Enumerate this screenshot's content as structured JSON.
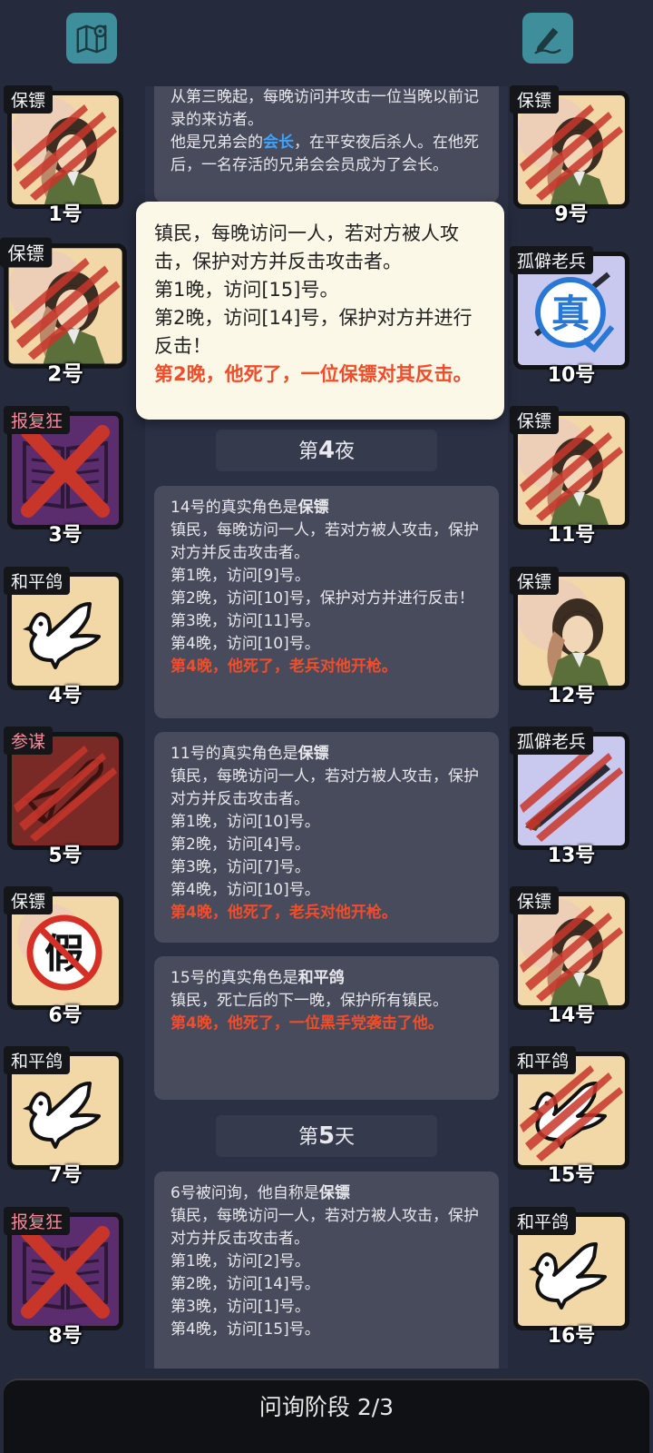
{
  "header": {
    "map_icon": "map-pin-icon",
    "notes_icon": "pen-note-icon"
  },
  "log": {
    "top_partial": {
      "line1": "从第三晚起，每晚访问并攻击一位当晚以前记录的来访者。",
      "line2_a": "他是兄弟会的",
      "line2_hl": "会长",
      "line2_b": "，在平安夜后杀人。在他死后，一名存活的兄弟会会员成为了会长。"
    },
    "night4_label": "第",
    "night4_num": "4",
    "night4_suffix": "夜",
    "entry14": {
      "head_a": "14号的真实角色是",
      "head_b": "保镖",
      "desc": "镇民，每晚访问一人，若对方被人攻击，保护对方并反击攻击者。",
      "lines": [
        "第1晚，访问[9]号。",
        "第2晚，访问[10]号，保护对方并进行反击！",
        "第3晚，访问[11]号。",
        "第4晚，访问[10]号。"
      ],
      "death": "第4晚，他死了，老兵对他开枪。"
    },
    "entry11": {
      "head_a": "11号的真实角色是",
      "head_b": "保镖",
      "desc": "镇民，每晚访问一人，若对方被人攻击，保护对方并反击攻击者。",
      "lines": [
        "第1晚，访问[10]号。",
        "第2晚，访问[4]号。",
        "第3晚，访问[7]号。",
        "第4晚，访问[10]号。"
      ],
      "death": "第4晚，他死了，老兵对他开枪。"
    },
    "entry15": {
      "head_a": "15号的真实角色是",
      "head_b": "和平鸽",
      "desc": "镇民，死亡后的下一晚，保护所有镇民。",
      "death": "第4晚，他死了，一位黑手党袭击了他。"
    },
    "day5_label": "第",
    "day5_num": "5",
    "day5_suffix": "天",
    "entry6": {
      "head_a": "6号被问询，他自称是",
      "head_b": "保镖",
      "desc": "镇民，每晚访问一人，若对方被人攻击，保护对方并反击攻击者。",
      "lines": [
        "第1晚，访问[2]号。",
        "第2晚，访问[14]号。",
        "第3晚，访问[1]号。",
        "第4晚，访问[15]号。"
      ]
    }
  },
  "popup": {
    "desc": "镇民，每晚访问一人，若对方被人攻击，保护对方并反击攻击者。",
    "lines": [
      "第1晚，访问[15]号。",
      "第2晚，访问[14]号，保护对方并进行反击！"
    ],
    "death": "第2晚，他死了，一位保镖对其反击。"
  },
  "players": [
    {
      "num": "1号",
      "role": "保镖"
    },
    {
      "num": "2号",
      "role": "保镖"
    },
    {
      "num": "3号",
      "role": "报复狂"
    },
    {
      "num": "4号",
      "role": "和平鸽"
    },
    {
      "num": "5号",
      "role": "参谋"
    },
    {
      "num": "6号",
      "role": "保镖",
      "badge": "假"
    },
    {
      "num": "7号",
      "role": "和平鸽"
    },
    {
      "num": "8号",
      "role": "报复狂"
    },
    {
      "num": "9号",
      "role": "保镖"
    },
    {
      "num": "10号",
      "role": "孤僻老兵",
      "badge": "真"
    },
    {
      "num": "11号",
      "role": "保镖"
    },
    {
      "num": "12号",
      "role": "保镖"
    },
    {
      "num": "13号",
      "role": "孤僻老兵"
    },
    {
      "num": "14号",
      "role": "保镖"
    },
    {
      "num": "15号",
      "role": "和平鸽"
    },
    {
      "num": "16号",
      "role": "和平鸽"
    }
  ],
  "footer": {
    "phase": "问询阶段 2/3"
  },
  "colors": {
    "background": "#252a3c",
    "highlight_red": "#f24d2a",
    "highlight_blue": "#3fa2ff",
    "card_tan": "#f2d7a7",
    "icon_teal": "#3f8e9c"
  }
}
